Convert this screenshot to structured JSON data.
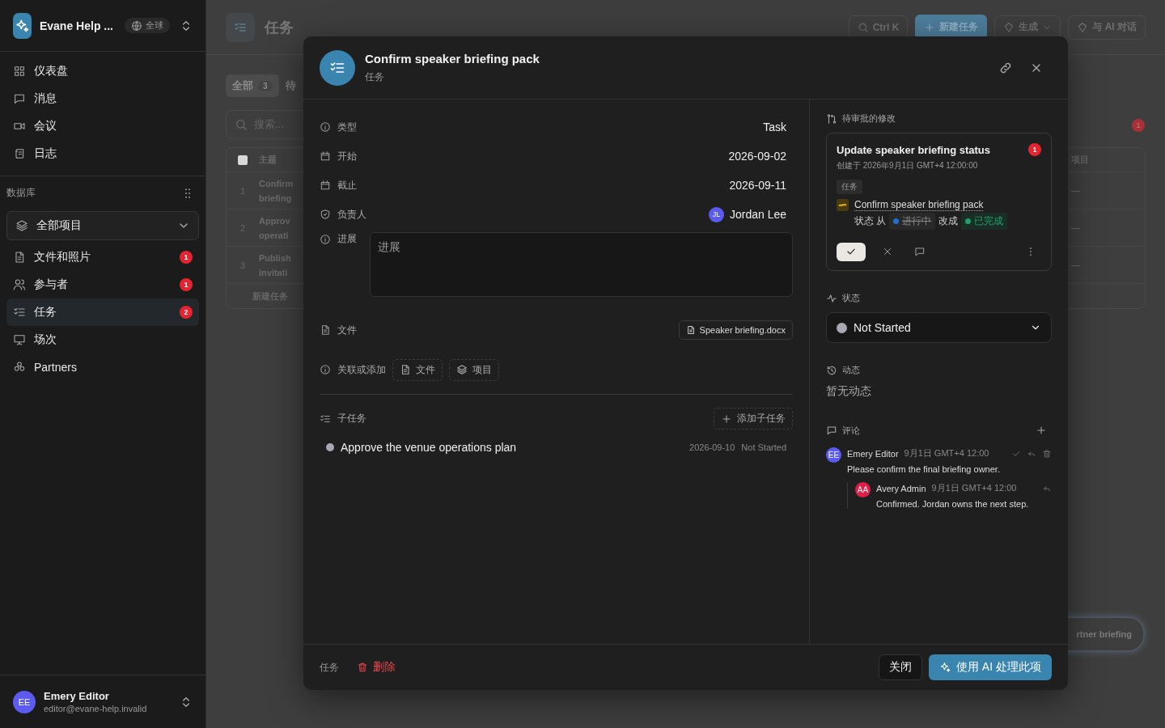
{
  "sidebar": {
    "workspace": "Evane Help ...",
    "scope": "全球",
    "nav": [
      {
        "label": "仪表盘"
      },
      {
        "label": "消息"
      },
      {
        "label": "会议"
      },
      {
        "label": "日志"
      }
    ],
    "section_title": "数据库",
    "project_select": "全部项目",
    "items": [
      {
        "label": "文件和照片",
        "badge": "1",
        "selected": false
      },
      {
        "label": "参与者",
        "badge": "1",
        "selected": false
      },
      {
        "label": "任务",
        "badge": "2",
        "selected": true
      },
      {
        "label": "场次",
        "selected": false
      },
      {
        "label": "Partners",
        "selected": false
      }
    ],
    "user": {
      "initials": "EE",
      "name": "Emery Editor",
      "email": "editor@evane-help.invalid"
    }
  },
  "page": {
    "title": "任务",
    "search_shortcut": "Ctrl K",
    "new_button": "新建任务",
    "generate_button": "生成",
    "ai_chat_button": "与 AI 对话",
    "filters": [
      {
        "label": "全部",
        "count": "3",
        "selected": true
      },
      {
        "label": "待",
        "selected": false
      }
    ],
    "search_placeholder": "搜索...",
    "table": {
      "select_all_checked": false,
      "columns": [
        "主题",
        "项目"
      ],
      "rows": [
        {
          "number": "1",
          "subject": "Confirm briefing",
          "project": "—"
        },
        {
          "number": "2",
          "subject": "Approv operati",
          "project": "—"
        },
        {
          "number": "3",
          "subject": "Publish invitati",
          "project": "—"
        }
      ],
      "new_row": "新建任务"
    },
    "notification_count": "1",
    "toast": "rtner briefing"
  },
  "modal": {
    "title": "Confirm speaker briefing pack",
    "subtitle": "任务",
    "fields": [
      {
        "kind": "text",
        "label": "类型",
        "value": "Task"
      },
      {
        "kind": "text",
        "label": "开始",
        "value": "2026-09-02"
      },
      {
        "kind": "text",
        "label": "截止",
        "value": "2026-09-11"
      },
      {
        "kind": "person",
        "label": "负责人",
        "initials": "JL",
        "color": "#5b5bf0",
        "value": "Jordan Lee"
      },
      {
        "kind": "textarea",
        "label": "进展",
        "placeholder": "进展"
      },
      {
        "kind": "file",
        "label": "文件",
        "value": "Speaker briefing.docx"
      }
    ],
    "link_label": "关联或添加",
    "link_buttons": [
      {
        "label": "文件"
      },
      {
        "label": "项目"
      }
    ],
    "subtasks": {
      "title": "子任务",
      "add_button": "添加子任务",
      "items": [
        {
          "title": "Approve the venue operations plan",
          "date": "2026-09-10",
          "status": "Not Started"
        }
      ]
    },
    "pending": {
      "title": "待审批的修改",
      "card": {
        "title": "Update speaker briefing status",
        "count": "1",
        "created": "创建于 2026年9月1日 GMT+4 12:00:00",
        "tag": "任务",
        "target": "Confirm speaker briefing pack",
        "change_prefix": "状态 从",
        "from": {
          "label": "进行中",
          "color": "#1f6fd1"
        },
        "change_mid": "改成",
        "to": {
          "label": "已完成",
          "color": "#22a06b"
        }
      }
    },
    "status": {
      "title": "状态",
      "value": "Not Started",
      "color": "#a8a8b3"
    },
    "activity": {
      "title": "动态",
      "empty": "暂无动态"
    },
    "comments": {
      "title": "评论",
      "items": [
        {
          "initials": "EE",
          "color": "#5b5bf0",
          "author": "Emery Editor",
          "time": "9月1日 GMT+4 12:00",
          "text": "Please confirm the final briefing owner.",
          "replies": [
            {
              "initials": "AA",
              "color": "#e11d48",
              "author": "Avery Admin",
              "time": "9月1日 GMT+4 12:00",
              "text": "Confirmed. Jordan owns the next step."
            }
          ]
        }
      ]
    },
    "footer": {
      "type_label": "任务",
      "delete_button": "删除",
      "close_button": "关闭",
      "ai_button": "使用 AI 处理此项"
    }
  }
}
